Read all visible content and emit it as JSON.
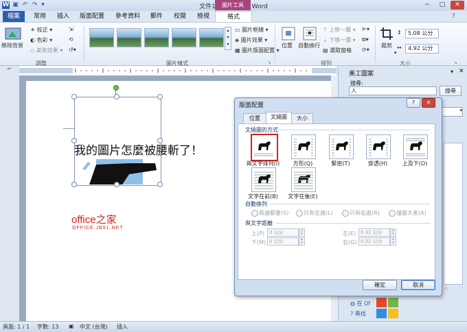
{
  "window": {
    "title": "文件1 - Microsoft Word",
    "contextual_tab": "圖片工具",
    "controls": {
      "minimize": "−",
      "maximize": "□",
      "close": "✕"
    }
  },
  "tabs": [
    {
      "label": "檔案"
    },
    {
      "label": "常用"
    },
    {
      "label": "插入"
    },
    {
      "label": "版面配置"
    },
    {
      "label": "參考資料"
    },
    {
      "label": "郵件"
    },
    {
      "label": "校閱"
    },
    {
      "label": "檢視"
    },
    {
      "label": "格式"
    }
  ],
  "ribbon": {
    "adjust": {
      "remove_bg": "移除背景",
      "correct": "校正",
      "color": "色彩",
      "artistic": "美術效果",
      "group": "調整"
    },
    "styles": {
      "border": "圖片框線",
      "effects": "圖片效果",
      "layout": "圖片版面配置",
      "group": "圖片樣式"
    },
    "arrange": {
      "position": "位置",
      "wrap": "自動換行",
      "bring_forward": "上移一層",
      "send_backward": "下移一層",
      "selection_pane": "選取窗格",
      "group": "排列"
    },
    "size": {
      "crop": "裁剪",
      "height": "5.08 公分",
      "width": "4.92 公分",
      "group": "大小"
    }
  },
  "document": {
    "heading": "我的圖片怎麼被腰斬了！",
    "watermark_big": "office之家",
    "watermark_small": "OFFICE.JB51.NET"
  },
  "pane": {
    "title": "美工圖案",
    "search_label": "搜尋:",
    "search_value": "人",
    "search_button": "搜尋",
    "link1": "在 Of",
    "link2": "尋找"
  },
  "dialog": {
    "title": "版面配置",
    "help": "?",
    "close": "✕",
    "tabs": [
      {
        "label": "位置"
      },
      {
        "label": "文繞圖"
      },
      {
        "label": "大小"
      }
    ],
    "wrap_section": "文繞圖的方式",
    "wrap_options": [
      {
        "label": "與文字排列(I)",
        "icon": "inline-icon"
      },
      {
        "label": "方形(Q)",
        "icon": "square-icon"
      },
      {
        "label": "緊密(T)",
        "icon": "tight-icon"
      },
      {
        "label": "穿透(H)",
        "icon": "through-icon"
      },
      {
        "label": "上及下(O)",
        "icon": "top-bottom-icon"
      },
      {
        "label": "文字在前(B)",
        "icon": "behind-text-icon"
      },
      {
        "label": "文字在後(E)",
        "icon": "in-front-icon"
      }
    ],
    "auto_wrap_section": "自動換列",
    "auto_wrap": [
      {
        "label": "兩邊都要(S)"
      },
      {
        "label": "只有左邊(L)"
      },
      {
        "label": "只有右邊(R)"
      },
      {
        "label": "僅最大者(A)"
      }
    ],
    "distance_section": "與文字距離",
    "distance": {
      "top_label": "上(P)",
      "top_value": "0 公分",
      "bottom_label": "下(M)",
      "bottom_value": "0 公分",
      "left_label": "左(E)",
      "left_value": "0.32 公分",
      "right_label": "右(G)",
      "right_value": "0.32 公分"
    },
    "ok": "確定",
    "cancel": "取消"
  },
  "status": {
    "page": "頁面: 1 / 1",
    "words": "字數: 13",
    "language": "中文 (台灣)",
    "mode": "插入"
  },
  "colors": {
    "accent": "#2c5ea8",
    "context": "#a8457a",
    "watermark": "#d0231f"
  }
}
